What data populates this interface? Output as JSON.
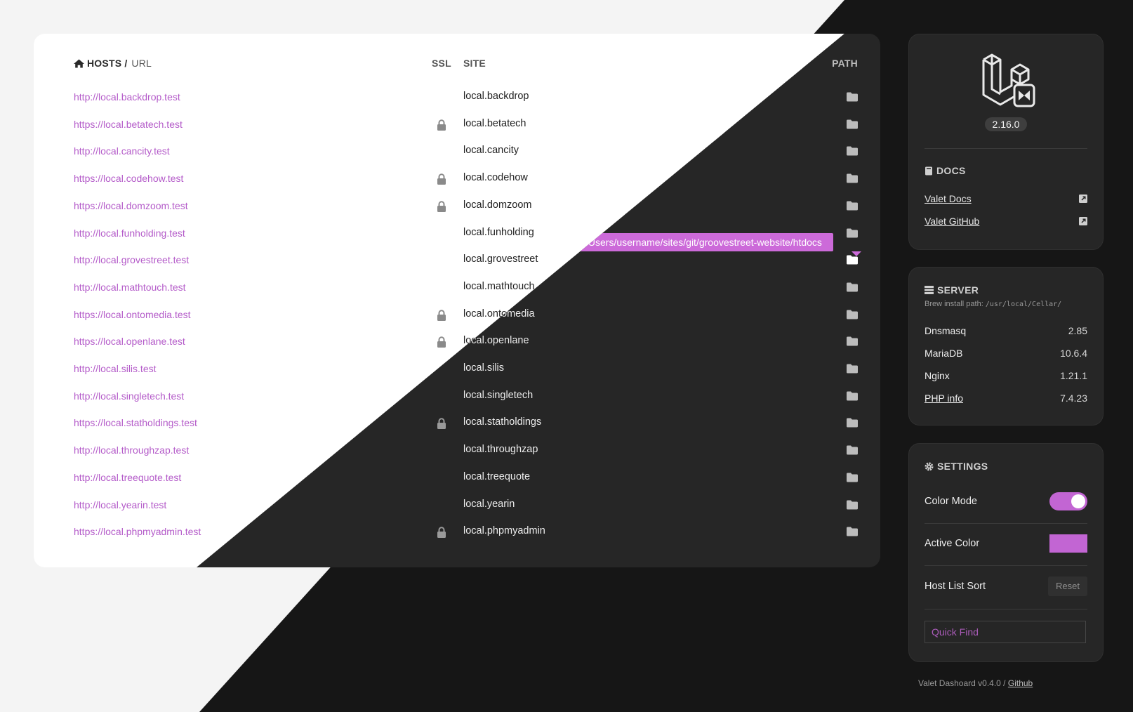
{
  "hosts": {
    "header": {
      "hosts_label": "HOSTS /",
      "url_label": "URL",
      "ssl_label": "SSL",
      "site_label": "SITE",
      "path_label": "PATH"
    },
    "rows": [
      {
        "url": "http://local.backdrop.test",
        "site": "local.backdrop",
        "ssl": false
      },
      {
        "url": "https://local.betatech.test",
        "site": "local.betatech",
        "ssl": true
      },
      {
        "url": "http://local.cancity.test",
        "site": "local.cancity",
        "ssl": false
      },
      {
        "url": "https://local.codehow.test",
        "site": "local.codehow",
        "ssl": true
      },
      {
        "url": "https://local.domzoom.test",
        "site": "local.domzoom",
        "ssl": true
      },
      {
        "url": "http://local.funholding.test",
        "site": "local.funholding",
        "ssl": false
      },
      {
        "url": "http://local.grovestreet.test",
        "site": "local.grovestreet",
        "ssl": false
      },
      {
        "url": "http://local.mathtouch.test",
        "site": "local.mathtouch",
        "ssl": false
      },
      {
        "url": "https://local.ontomedia.test",
        "site": "local.ontomedia",
        "ssl": true
      },
      {
        "url": "https://local.openlane.test",
        "site": "local.openlane",
        "ssl": true
      },
      {
        "url": "http://local.silis.test",
        "site": "local.silis",
        "ssl": false
      },
      {
        "url": "http://local.singletech.test",
        "site": "local.singletech",
        "ssl": false
      },
      {
        "url": "https://local.statholdings.test",
        "site": "local.statholdings",
        "ssl": true
      },
      {
        "url": "http://local.throughzap.test",
        "site": "local.throughzap",
        "ssl": false
      },
      {
        "url": "http://local.treequote.test",
        "site": "local.treequote",
        "ssl": false
      },
      {
        "url": "http://local.yearin.test",
        "site": "local.yearin",
        "ssl": false
      },
      {
        "url": "https://local.phpmyadmin.test",
        "site": "local.phpmyadmin",
        "ssl": true
      }
    ],
    "tooltip": "/Users/username/sites/git/groovestreet-website/htdocs",
    "icons": {
      "header": "home-icon",
      "ssl": "lock-icon",
      "path": "folder-icon"
    }
  },
  "brand": {
    "version": "2.16.0",
    "logo": "laravel-valet-logo"
  },
  "docs": {
    "title": "DOCS",
    "links": [
      {
        "label": "Valet Docs"
      },
      {
        "label": "Valet GitHub"
      }
    ]
  },
  "server": {
    "title": "SERVER",
    "brew_label": "Brew install path:",
    "brew_path": "/usr/local/Cellar/",
    "items": [
      {
        "name": "Dnsmasq",
        "version": "2.85"
      },
      {
        "name": "MariaDB",
        "version": "10.6.4"
      },
      {
        "name": "Nginx",
        "version": "1.21.1"
      },
      {
        "name": "PHP info",
        "version": "7.4.23"
      }
    ]
  },
  "settings": {
    "title": "SETTINGS",
    "color_mode_label": "Color Mode",
    "color_mode_on": true,
    "active_color_label": "Active Color",
    "active_color": "#c265d3",
    "sort_label": "Host List Sort",
    "reset_label": "Reset",
    "find_placeholder": "Quick Find"
  },
  "footer": {
    "text": "Valet Dashoard v0.4.0 /",
    "link": "Github"
  },
  "colors": {
    "accent": "#c265d3",
    "dark_bg": "#161616",
    "card_dark": "#262626",
    "light_bg": "#f4f4f4"
  }
}
